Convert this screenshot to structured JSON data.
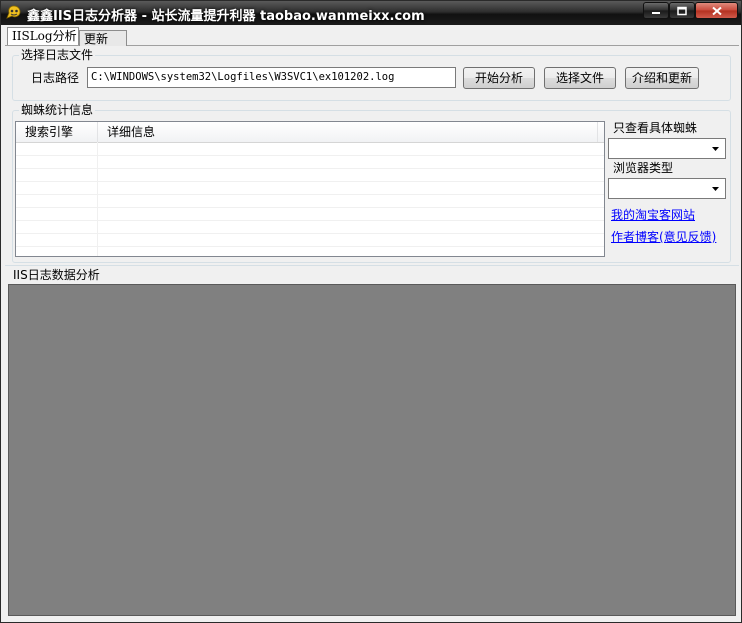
{
  "window": {
    "title": "鑫鑫IIS日志分析器 - 站长流量提升利器 taobao.wanmeixx.com"
  },
  "tabs": [
    {
      "label": "IISLog分析",
      "active": true
    },
    {
      "label": "更新",
      "active": false
    }
  ],
  "log_file_group": {
    "title": "选择日志文件",
    "path_label": "日志路径",
    "path_value": "C:\\WINDOWS\\system32\\Logfiles\\W3SVC1\\ex101202.log",
    "start_button": "开始分析",
    "select_button": "选择文件",
    "about_button": "介绍和更新"
  },
  "spider_group": {
    "title": "蜘蛛统计信息",
    "columns": [
      "搜索引擎",
      "详细信息"
    ],
    "rows": []
  },
  "filters": {
    "spider_label": "只查看具体蜘蛛",
    "spider_selected": "",
    "browser_label": "浏览器类型",
    "browser_selected": ""
  },
  "links": {
    "shop": "我的淘宝客网站",
    "blog": "作者博客(意见反馈)"
  },
  "data_section": {
    "title": "IIS日志数据分析"
  },
  "colors": {
    "link": "#0000ff",
    "panel_gray": "#808080",
    "close_button": "#c9483a"
  },
  "icons": [
    "app-icon",
    "minimize-icon",
    "maximize-icon",
    "close-icon",
    "dropdown-arrow-icon"
  ]
}
